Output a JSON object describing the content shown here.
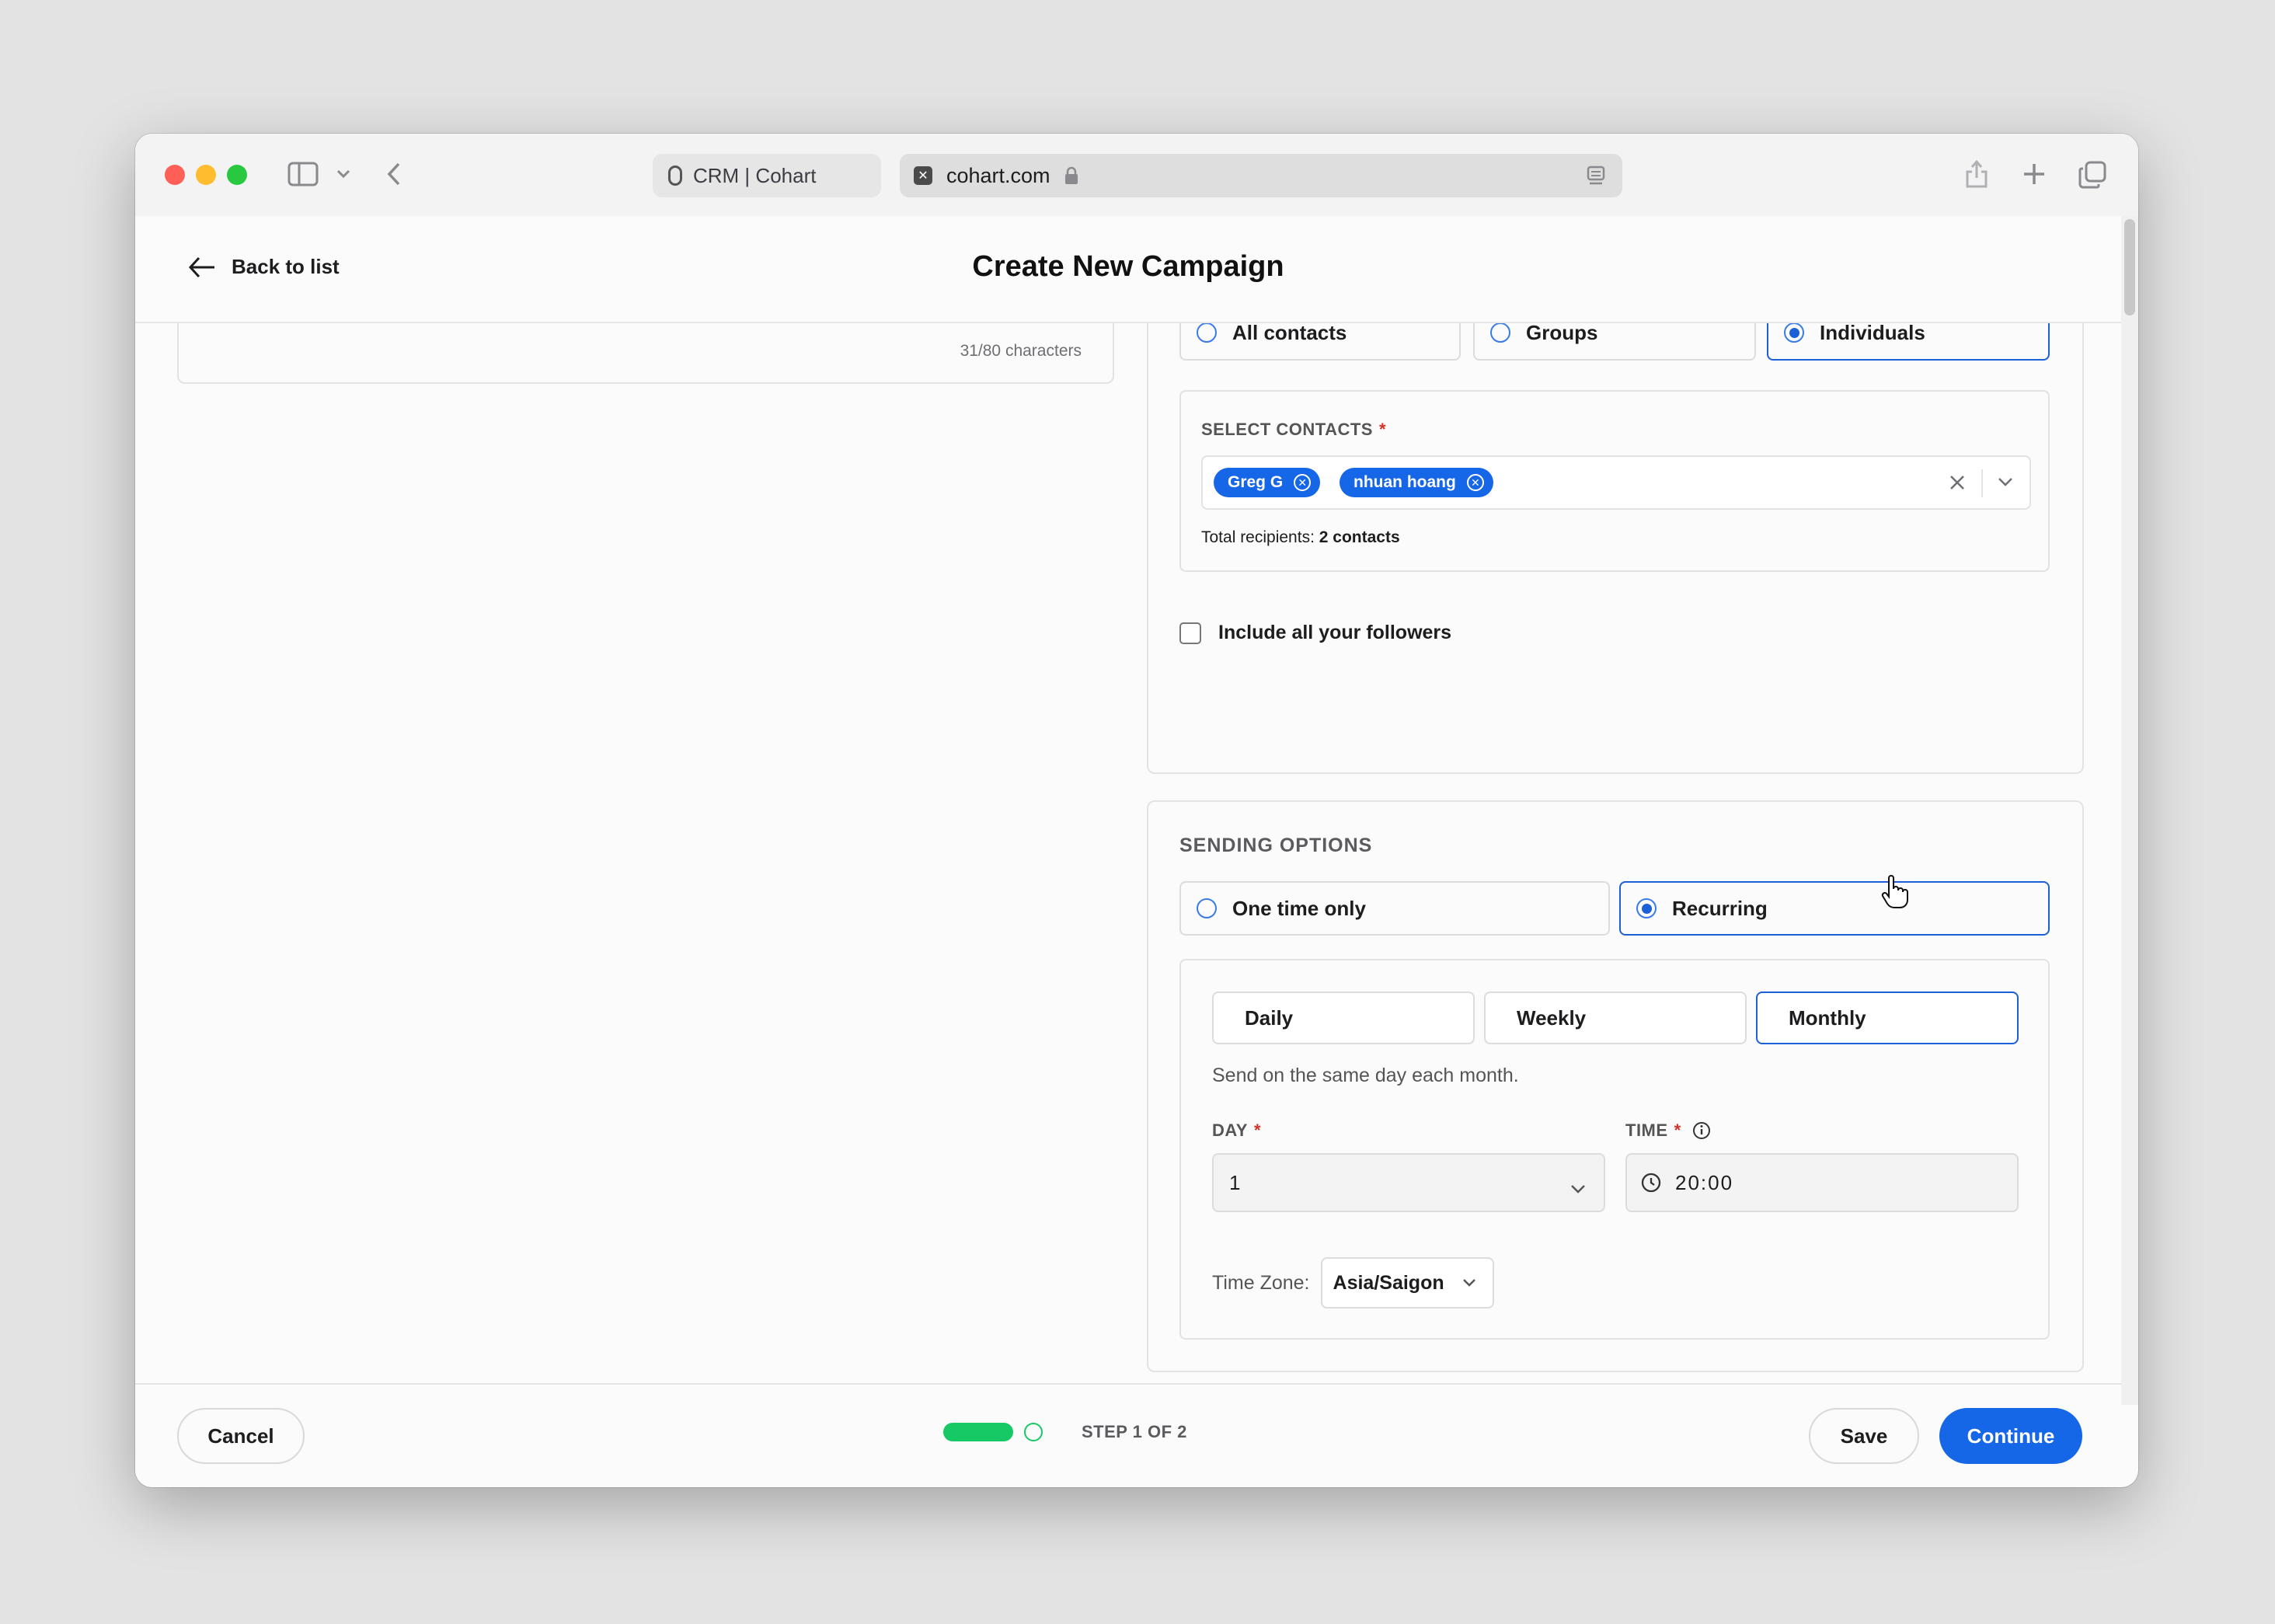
{
  "browser": {
    "tab_title": "CRM | Cohart",
    "url": "cohart.com"
  },
  "header": {
    "back_label": "Back to list",
    "title": "Create New Campaign"
  },
  "message_card": {
    "char_count": "31/80 characters"
  },
  "recipients": {
    "options": [
      "All contacts",
      "Groups",
      "Individuals"
    ],
    "selected": "Individuals",
    "select_label": "SELECT CONTACTS",
    "required_mark": "*",
    "chips": [
      "Greg G",
      "nhuan hoang"
    ],
    "total_prefix": "Total recipients: ",
    "total_value": "2 contacts",
    "followers_label": "Include all your followers"
  },
  "sending": {
    "title": "SENDING OPTIONS",
    "options": [
      "One time only",
      "Recurring"
    ],
    "selected": "Recurring",
    "frequencies": [
      "Daily",
      "Weekly",
      "Monthly"
    ],
    "selected_frequency": "Monthly",
    "description": "Send on the same day each month.",
    "day_label": "DAY",
    "day_value": "1",
    "time_label": "TIME",
    "time_value": "20:00",
    "timezone_label": "Time Zone:",
    "timezone_value": "Asia/Saigon"
  },
  "footer": {
    "cancel": "Cancel",
    "step": "STEP 1 OF 2",
    "save": "Save",
    "continue": "Continue"
  },
  "colors": {
    "primary": "#1666e8",
    "progress": "#17c964",
    "required": "#d93025"
  }
}
